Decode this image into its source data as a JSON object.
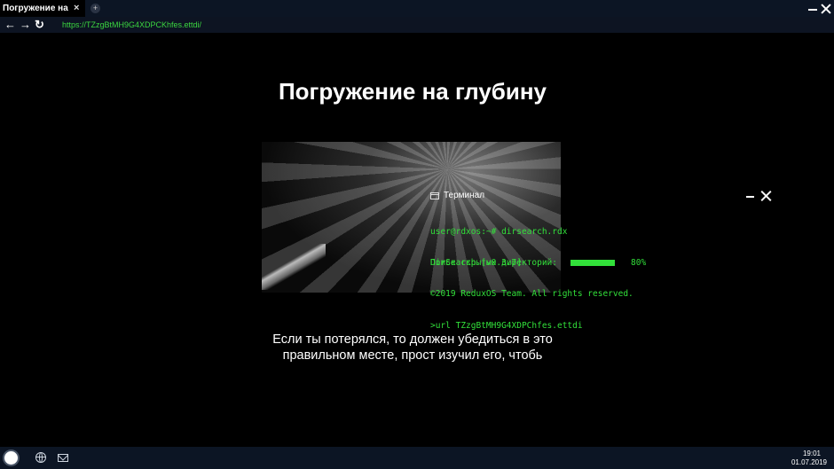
{
  "browser": {
    "tab_title": "Погружение на",
    "tab_close": "×",
    "new_tab": "+",
    "url": "https://TZzgBtMH9G4XDPCKhfes.ettdi/",
    "back": "←",
    "forward": "→",
    "reload": "↻"
  },
  "page": {
    "title": "Погружение на глубину",
    "intro": "Если ты потерялся, то должен убедиться в это правильном месте, прост изучил его, чтобь"
  },
  "terminal": {
    "title": "Терминал",
    "lines": [
      "user@rdxos:~# dirsearch.rdx",
      "DirSearch [v0.3.7]",
      "©2019 ReduxOS Team. All rights reserved.",
      ">url TZzgBtMH9G4XDPChfes.ettdi"
    ],
    "progress_label": "Поиск скрытых директорий:",
    "progress_percent": "80%",
    "progress_value": 0.8
  },
  "taskbar": {
    "time": "19:01",
    "date": "01.07.2019"
  },
  "colors": {
    "terminal_green": "#32e03a",
    "url_green": "#3bd640",
    "chrome_bg": "#0c1524"
  }
}
